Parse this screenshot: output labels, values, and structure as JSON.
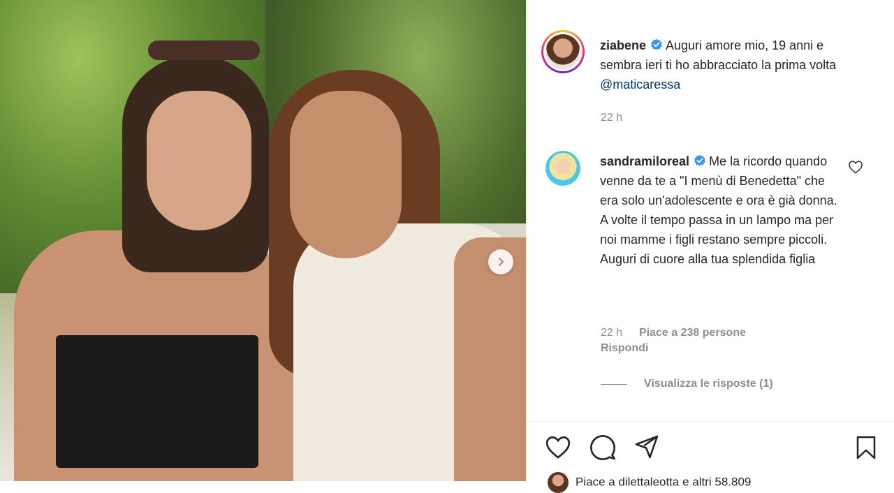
{
  "post": {
    "author": "ziabene",
    "caption_text": "Auguri amore mio, 19 anni e sembra ieri ti ho abbracciato la prima volta",
    "caption_mention": "@maticaressa",
    "time": "22 h"
  },
  "comment": {
    "author": "sandramiloreal",
    "text": "Me la ricordo quando venne da te a \"I menù di Benedetta\" che era solo un'adolescente e ora è già donna. A volte il tempo passa in un lampo ma per noi mamme i figli restano sempre piccoli. Auguri di cuore alla tua splendida figlia",
    "time": "22 h",
    "likes": "Piace a 238 persone",
    "reply": "Rispondi",
    "view_replies": "Visualizza le risposte (1)"
  },
  "likers": {
    "text": "Piace a dilettaleotta e altri 58.809"
  },
  "colors": {
    "verified": "#3897f0",
    "mention": "#00376b",
    "muted": "#8e8e8e",
    "text": "#262626"
  },
  "icons": [
    "verified-badge-icon",
    "heart-icon",
    "comment-icon",
    "share-icon",
    "bookmark-icon",
    "chevron-right-icon"
  ]
}
